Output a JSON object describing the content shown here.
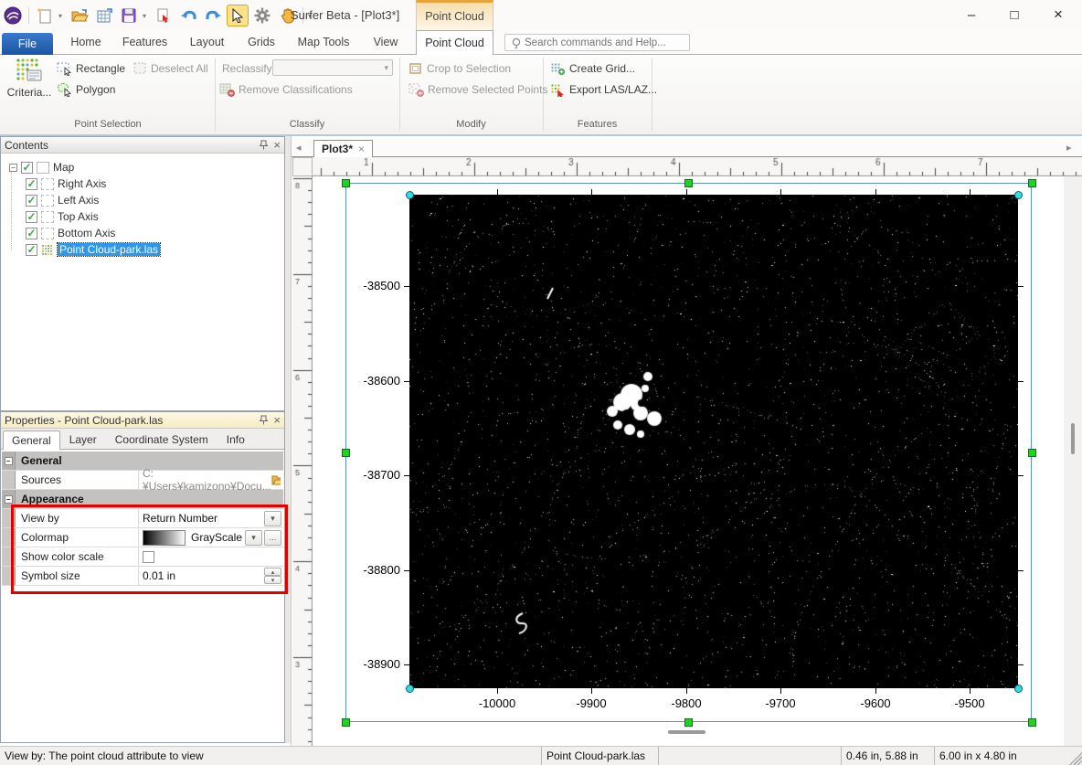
{
  "window": {
    "title": "Surfer Beta - [Plot3*]",
    "contextual_tab": "Point Cloud",
    "controls": {
      "minimize": "–",
      "maximize": "□",
      "close": "×"
    }
  },
  "ribbon_tabs": [
    "File",
    "Home",
    "Features",
    "Layout",
    "Grids",
    "Map Tools",
    "View",
    "Point Cloud"
  ],
  "search_placeholder": "Search commands and Help...",
  "ribbon": {
    "point_selection": {
      "label": "Point Selection",
      "criteria": "Criteria...",
      "rectangle": "Rectangle",
      "polygon": "Polygon",
      "deselect_all": "Deselect All"
    },
    "classify": {
      "label": "Classify",
      "reclassify": "Reclassify:",
      "remove_classifications": "Remove Classifications"
    },
    "modify": {
      "label": "Modify",
      "crop_to_selection": "Crop to Selection",
      "remove_selected_points": "Remove Selected Points"
    },
    "features": {
      "label": "Features",
      "create_grid": "Create Grid...",
      "export_laslaz": "Export LAS/LAZ..."
    }
  },
  "contents": {
    "title": "Contents",
    "tree": [
      {
        "label": "Map"
      },
      {
        "label": "Right Axis"
      },
      {
        "label": "Left Axis"
      },
      {
        "label": "Top Axis"
      },
      {
        "label": "Bottom Axis"
      },
      {
        "label": "Point Cloud-park.las"
      }
    ]
  },
  "properties": {
    "title": "Properties - Point Cloud-park.las",
    "tabs": [
      "General",
      "Layer",
      "Coordinate System",
      "Info"
    ],
    "general": {
      "header": "General",
      "sources_label": "Sources",
      "sources_value": "C:¥Users¥kamizono¥Docu..."
    },
    "appearance": {
      "header": "Appearance",
      "view_by_label": "View by",
      "view_by_value": "Return Number",
      "colormap_label": "Colormap",
      "colormap_value": "GrayScale",
      "colormap_more": "...",
      "show_color_scale_label": "Show color scale",
      "symbol_size_label": "Symbol size",
      "symbol_size_value": "0.01 in"
    }
  },
  "plot": {
    "doc_tab": "Plot3*",
    "ruler_h_labels": [
      "1",
      "2",
      "3",
      "4",
      "5",
      "6",
      "7"
    ],
    "ruler_v_labels": [
      "8",
      "7",
      "6",
      "5",
      "4",
      "3"
    ],
    "y_axis_labels": [
      "-38500",
      "-38600",
      "-38700",
      "-38800",
      "-38900"
    ],
    "x_axis_labels": [
      "-10000",
      "-9900",
      "-9800",
      "-9700",
      "-9600",
      "-9500"
    ]
  },
  "statusbar": {
    "hint": "View by: The point cloud attribute to view",
    "layer": "Point Cloud-park.las",
    "empty": "",
    "position": "0.46 in, 5.88 in",
    "size": "6.00 in x 4.80 in"
  },
  "colors": {
    "accent_orange": "#e8a33d",
    "file_tab_blue": "#1d5fae",
    "selection_blue": "#5b8fd4",
    "handle_green": "#1ed321",
    "handle_cyan": "#35dbe2",
    "highlight_red": "#e00000"
  }
}
